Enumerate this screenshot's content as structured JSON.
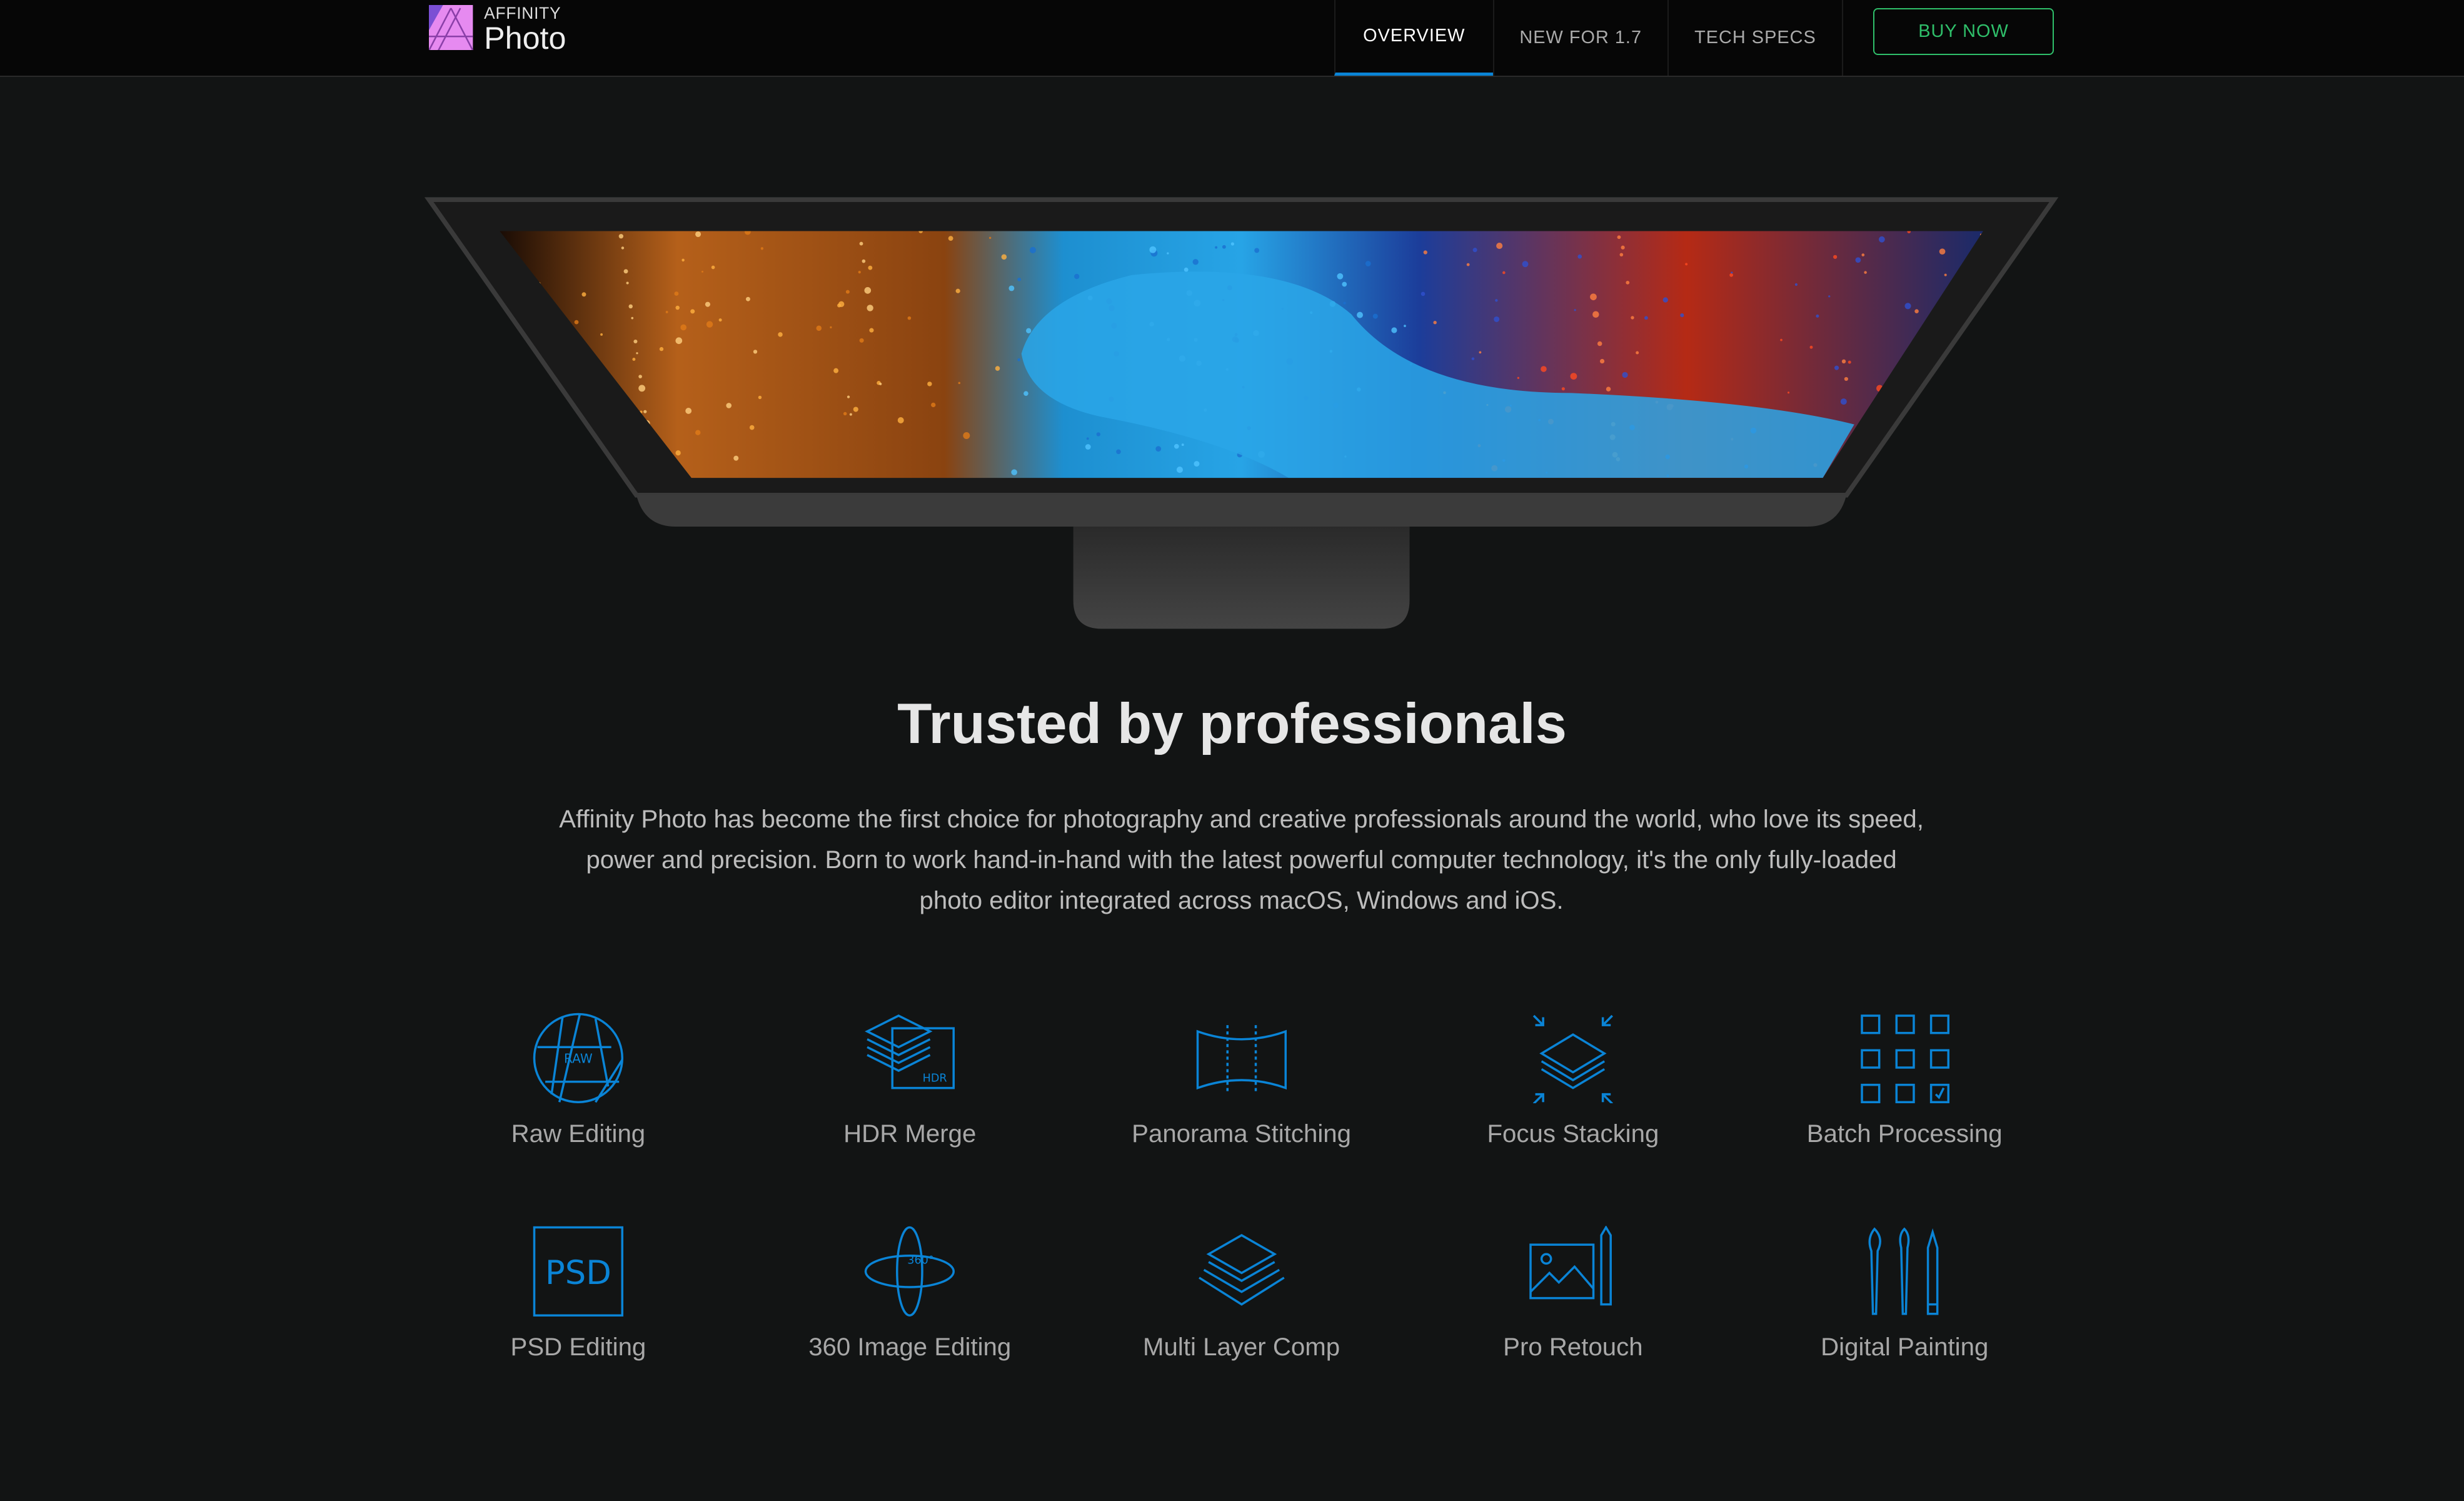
{
  "header": {
    "logo": {
      "small": "AFFINITY",
      "big": "Photo"
    },
    "nav": [
      {
        "label": "OVERVIEW",
        "active": true
      },
      {
        "label": "NEW FOR 1.7",
        "active": false
      },
      {
        "label": "TECH SPECS",
        "active": false
      }
    ],
    "buy_label": "BUY NOW"
  },
  "colors": {
    "accent": "#0a84d6",
    "buy": "#2fbf6a",
    "background": "#121414"
  },
  "main": {
    "title": "Trusted by professionals",
    "intro": "Affinity Photo has become the first choice for photography and creative professionals around the world, who love its speed, power and precision. Born to work hand-in-hand with the latest powerful computer technology, it's the only fully-loaded photo editor integrated across macOS, Windows and iOS.",
    "features": [
      {
        "label": "Raw Editing",
        "icon": "aperture-raw-icon",
        "badge": "RAW"
      },
      {
        "label": "HDR Merge",
        "icon": "hdr-layers-icon",
        "badge": "HDR"
      },
      {
        "label": "Panorama Stitching",
        "icon": "panorama-icon"
      },
      {
        "label": "Focus Stacking",
        "icon": "focus-stack-icon"
      },
      {
        "label": "Batch Processing",
        "icon": "batch-grid-icon"
      },
      {
        "label": "PSD Editing",
        "icon": "psd-file-icon",
        "badge": "PSD"
      },
      {
        "label": "360 Image Editing",
        "icon": "sphere-360-icon",
        "badge": "360°"
      },
      {
        "label": "Multi Layer Comp",
        "icon": "layers-icon"
      },
      {
        "label": "Pro Retouch",
        "icon": "image-pencil-icon"
      },
      {
        "label": "Digital Painting",
        "icon": "brushes-icon"
      }
    ]
  }
}
